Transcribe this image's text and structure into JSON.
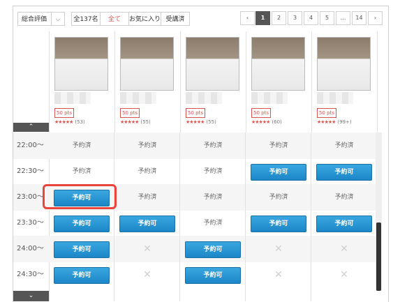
{
  "toolbar": {
    "sort_label": "総合評価",
    "sort_caret": "⌵",
    "tabs": [
      "全137名",
      "全て",
      "お気に入り",
      "受講済"
    ]
  },
  "pagination": {
    "prev": "‹",
    "pages": [
      "1",
      "2",
      "3",
      "4",
      "5",
      "…",
      "14"
    ],
    "next": "›",
    "current": "1"
  },
  "teachers": [
    {
      "pts": "50 pts",
      "stars": "★★★★★",
      "count": "(53)"
    },
    {
      "pts": "50 pts",
      "stars": "★★★★★",
      "count": "(55)"
    },
    {
      "pts": "50 pts",
      "stars": "★★★★★",
      "count": "(55)"
    },
    {
      "pts": "50 pts",
      "stars": "★★★★★",
      "count": "(60)"
    },
    {
      "pts": "50 pts",
      "stars": "★★★★★",
      "count": "(99+)"
    }
  ],
  "nav": {
    "up": "⌃",
    "down": "⌄"
  },
  "schedule": {
    "rows": [
      {
        "time": "22:00〜",
        "cells": [
          "予約済",
          "予約済",
          "予約済",
          "予約済",
          "予約済"
        ]
      },
      {
        "time": "22:30〜",
        "cells": [
          "予約済",
          "予約済",
          "予約済",
          "予約可",
          "予約可"
        ]
      },
      {
        "time": "23:00〜",
        "cells": [
          "予約可",
          "予約済",
          "予約済",
          "予約済",
          "予約済"
        ]
      },
      {
        "time": "23:30〜",
        "cells": [
          "予約可",
          "予約可",
          "予約済",
          "予約可",
          "予約可"
        ]
      },
      {
        "time": "24:00〜",
        "cells": [
          "予約可",
          "✕",
          "予約可",
          "✕",
          "✕"
        ]
      },
      {
        "time": "24:30〜",
        "cells": [
          "予約可",
          "✕",
          "予約可",
          "✕",
          "✕"
        ]
      }
    ]
  }
}
